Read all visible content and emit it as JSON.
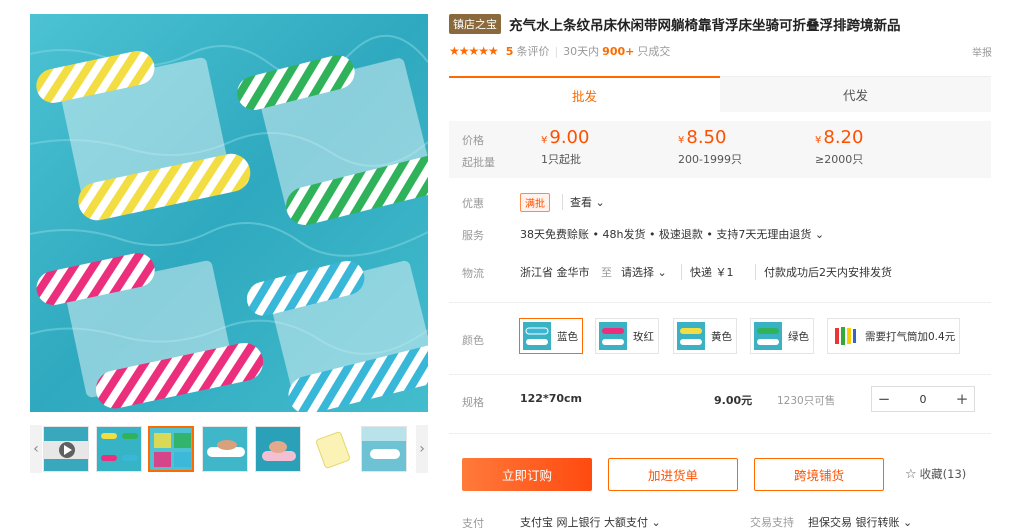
{
  "gallery": {
    "prev_arrow": "‹",
    "next_arrow": "›",
    "thumbnails": [
      "video-thumbnail",
      "hammock-group-view",
      "hammock-top-view",
      "model-on-hammock",
      "model-floating",
      "hammock-flat",
      "pool-scene"
    ]
  },
  "product": {
    "shop_tag": "镇店之宝",
    "title": "充气水上条纹吊床休闲带网躺椅靠背浮床坐骑可折叠浮排跨境新品",
    "rating_count": "5",
    "rating_suffix": "条评价",
    "sales_period": "30天内",
    "sales_count": "900+",
    "sales_suffix": "只成交",
    "report_label": "举报",
    "stars": "★★★★★"
  },
  "tabs": {
    "wholesale": "批发",
    "dropship": "代发"
  },
  "pricing": {
    "price_label": "价格",
    "moq_label": "起批量",
    "currency": "¥",
    "tiers": [
      {
        "price": "9.00",
        "quantity": "1只起批"
      },
      {
        "price": "8.50",
        "quantity": "200-1999只"
      },
      {
        "price": "8.20",
        "quantity": "≥2000只"
      }
    ]
  },
  "discount": {
    "label": "优惠",
    "badge": "满批",
    "view": "查看 ⌄"
  },
  "service": {
    "label": "服务",
    "text": "38天免费赊账 • 48h发货 • 极速退款 • 支持7天无理由退货 ⌄"
  },
  "logistics": {
    "label": "物流",
    "origin": "浙江省 金华市",
    "to": "至",
    "select": "请选择 ⌄",
    "express": "快递 ￥1",
    "note": "付款成功后2天内安排发货"
  },
  "colors": {
    "label": "颜色",
    "options": [
      {
        "name": "蓝色"
      },
      {
        "name": "玫红"
      },
      {
        "name": "黄色"
      },
      {
        "name": "绿色"
      },
      {
        "name": "需要打气筒加0.4元"
      }
    ]
  },
  "spec": {
    "label": "规格",
    "name": "122*70cm",
    "price": "9.00元",
    "stock": "1230只可售",
    "minus": "−",
    "quantity": "0",
    "plus": "+"
  },
  "actions": {
    "order_now": "立即订购",
    "add_to_cart": "加进货单",
    "cross_border": "跨境铺货",
    "favorite_star": "☆",
    "favorite": "收藏(13)"
  },
  "payment": {
    "label": "支付",
    "methods": "支付宝  网上银行  大额支付 ⌄",
    "trade_label": "交易支持",
    "trade": "担保交易  银行转账 ⌄"
  },
  "palette": {
    "accent": "#ff6a00",
    "pool": "#37b3c6",
    "yellow": "#f2dd42",
    "green": "#2fb25a",
    "pink": "#ec2f7c",
    "blue": "#39b7d8"
  }
}
